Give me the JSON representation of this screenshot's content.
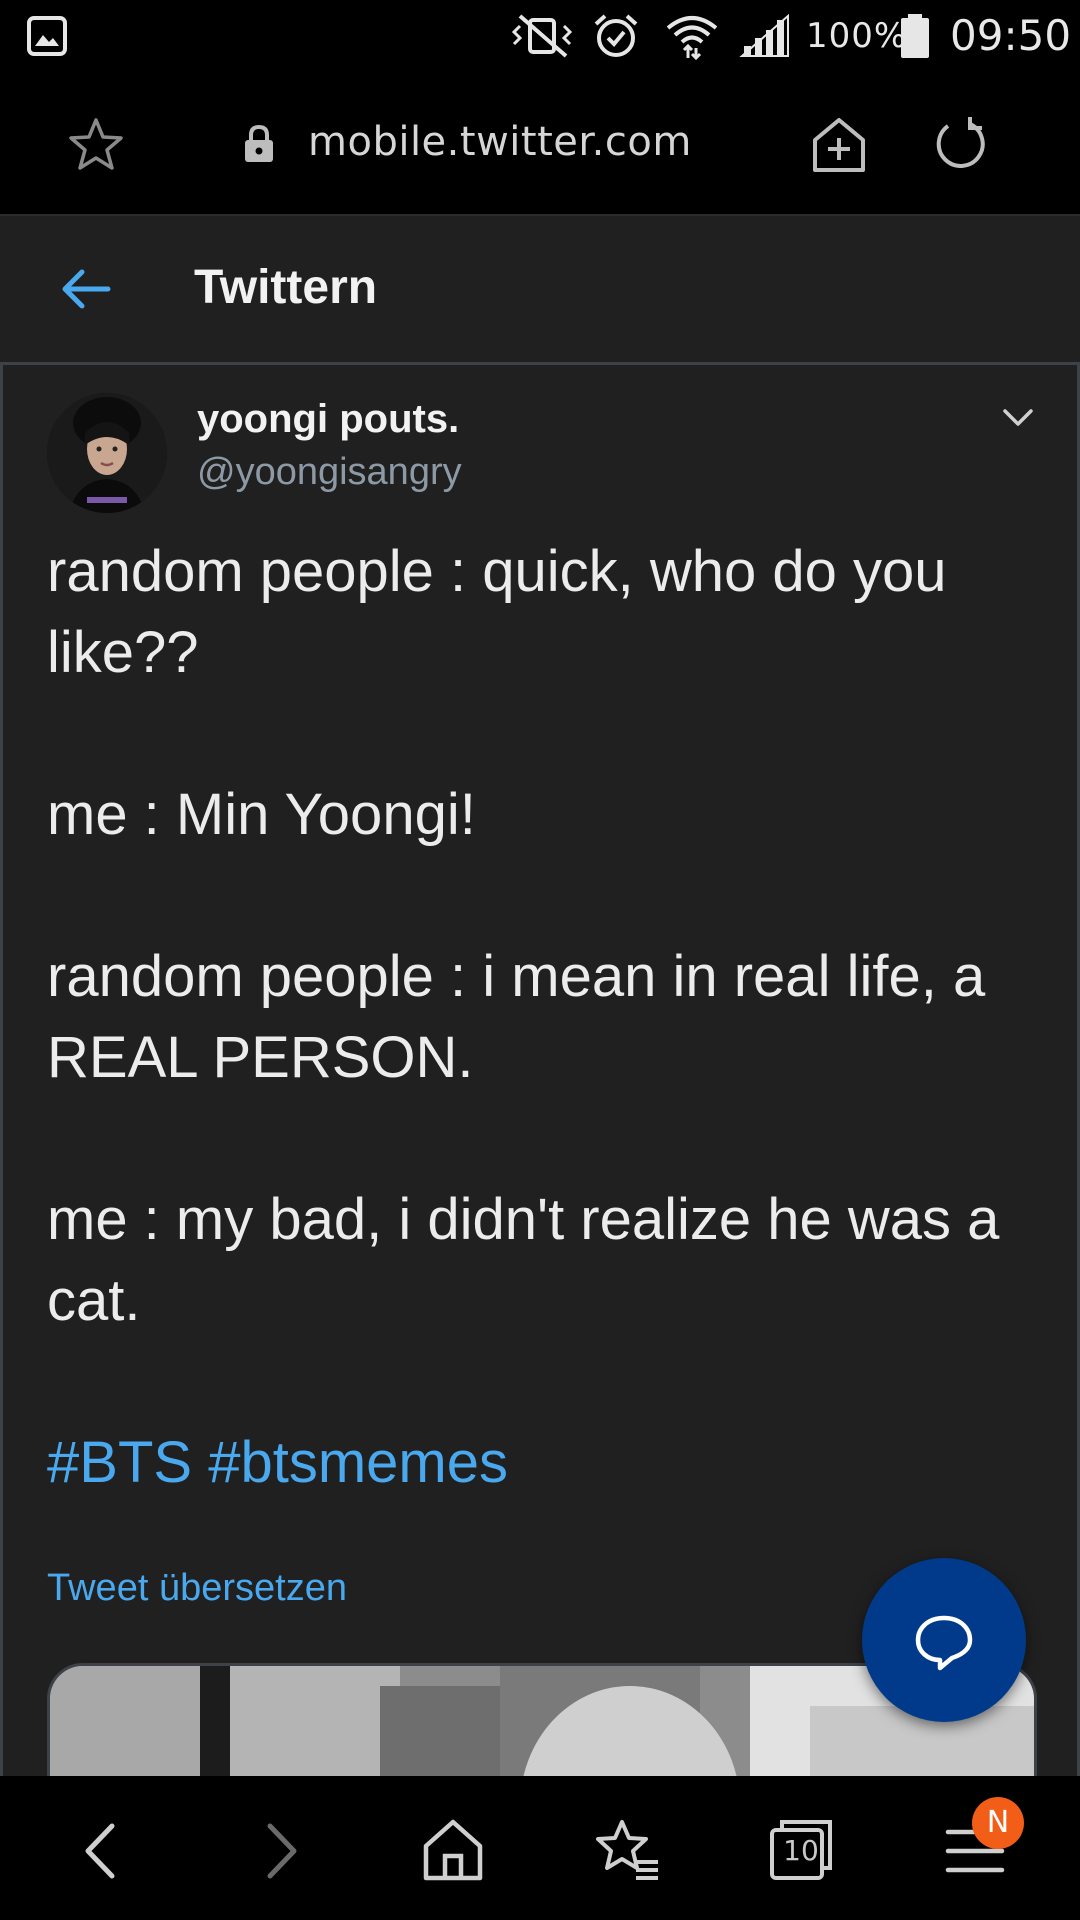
{
  "status_bar": {
    "battery_percent": "100%",
    "time": "09:50",
    "icons": [
      "gallery-icon",
      "mute-vibrate-icon",
      "alarm-icon",
      "wifi-icon",
      "signal-icon",
      "battery-icon"
    ]
  },
  "browser": {
    "url": "mobile.twitter.com",
    "icons": [
      "star-icon",
      "lock-icon",
      "add-to-home-icon",
      "reload-icon"
    ]
  },
  "header": {
    "title": "Twittern"
  },
  "tweet": {
    "display_name": "yoongi pouts.",
    "handle": "@yoongisangry",
    "paragraphs": [
      "random people : quick, who do you like??",
      "me : Min Yoongi!",
      "random people : i mean in real life, a REAL PERSON.",
      "me : my bad, i didn't realize he was a cat."
    ],
    "hashtags": [
      "#BTS",
      "#btsmemes"
    ],
    "translate_label": "Tweet übersetzen"
  },
  "bottom_nav": {
    "tabs_count": "10",
    "notification_badge": "N",
    "icons": [
      "back-icon",
      "forward-icon",
      "home-icon",
      "bookmarks-icon",
      "tabs-icon",
      "menu-icon"
    ]
  },
  "colors": {
    "background": "#202020",
    "link": "#4aa8ee",
    "fab": "#013a8a",
    "badge": "#f25d17"
  }
}
